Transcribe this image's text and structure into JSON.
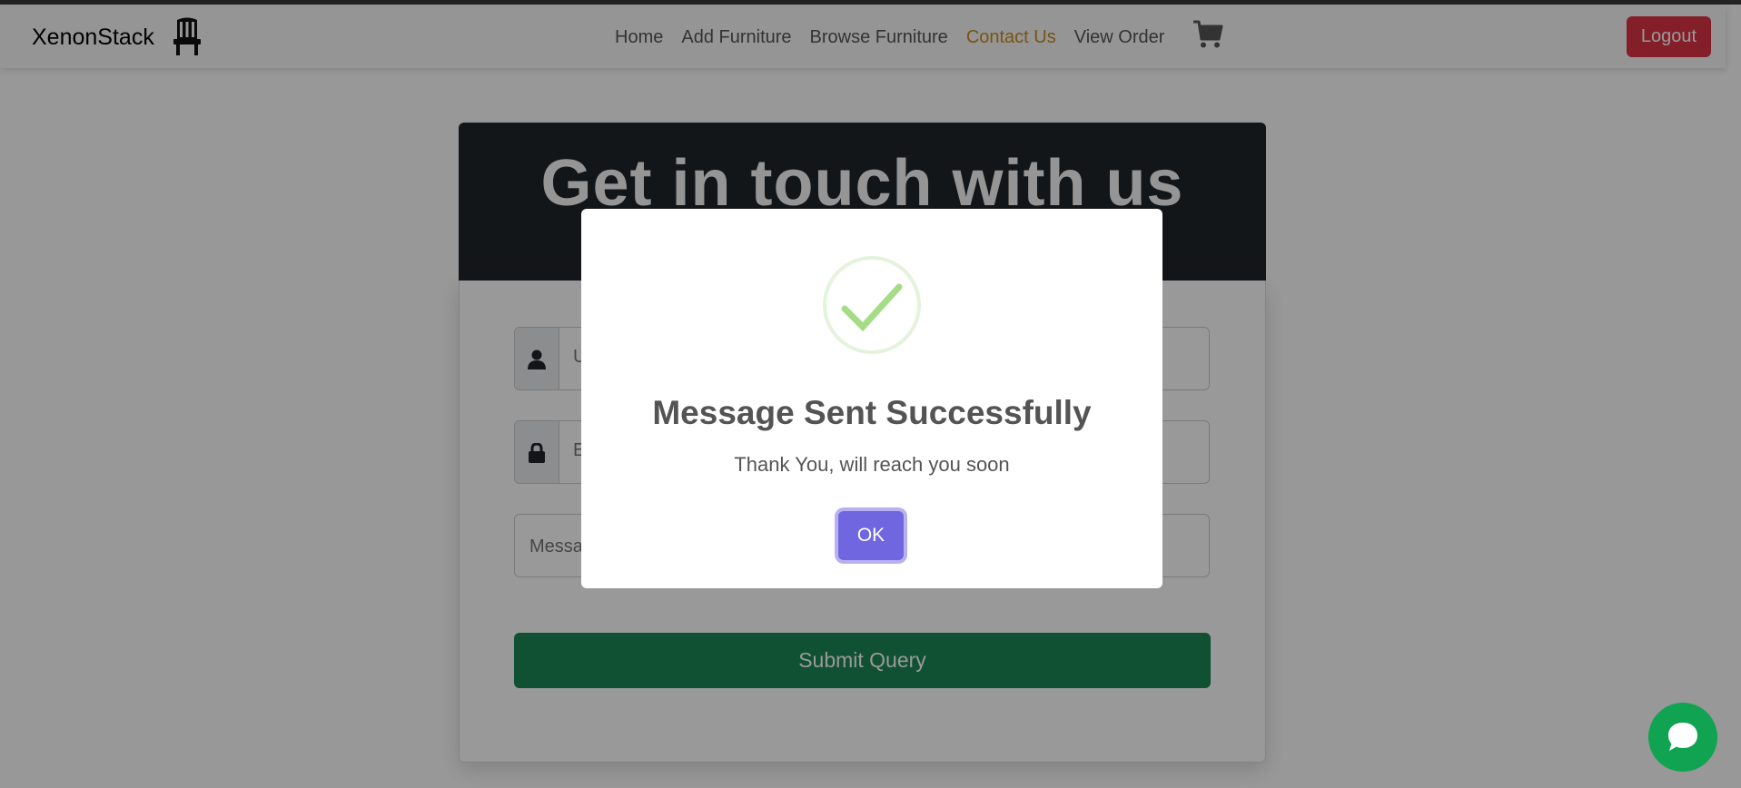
{
  "navbar": {
    "brand": "XenonStack",
    "links": [
      "Home",
      "Add Furniture",
      "Browse Furniture",
      "Contact Us",
      "View Order"
    ],
    "active_link": "Contact Us",
    "logout_label": "Logout"
  },
  "hero": {
    "title": "Get in touch with us"
  },
  "form": {
    "username_placeholder": "Username",
    "email_placeholder": "Email",
    "message_placeholder": "Message",
    "submit_label": "Submit Query"
  },
  "modal": {
    "title": "Message Sent Successfully",
    "text": "Thank You, will reach you soon",
    "ok_label": "OK"
  },
  "colors": {
    "accent": "#7066e0",
    "success": "#a5dc86",
    "submit": "#198754",
    "logout": "#dc3545",
    "active_link": "#c88a1a"
  },
  "icons": [
    "chair-icon",
    "cart-icon",
    "user-icon",
    "lock-icon",
    "success-check-icon",
    "chat-icon"
  ]
}
